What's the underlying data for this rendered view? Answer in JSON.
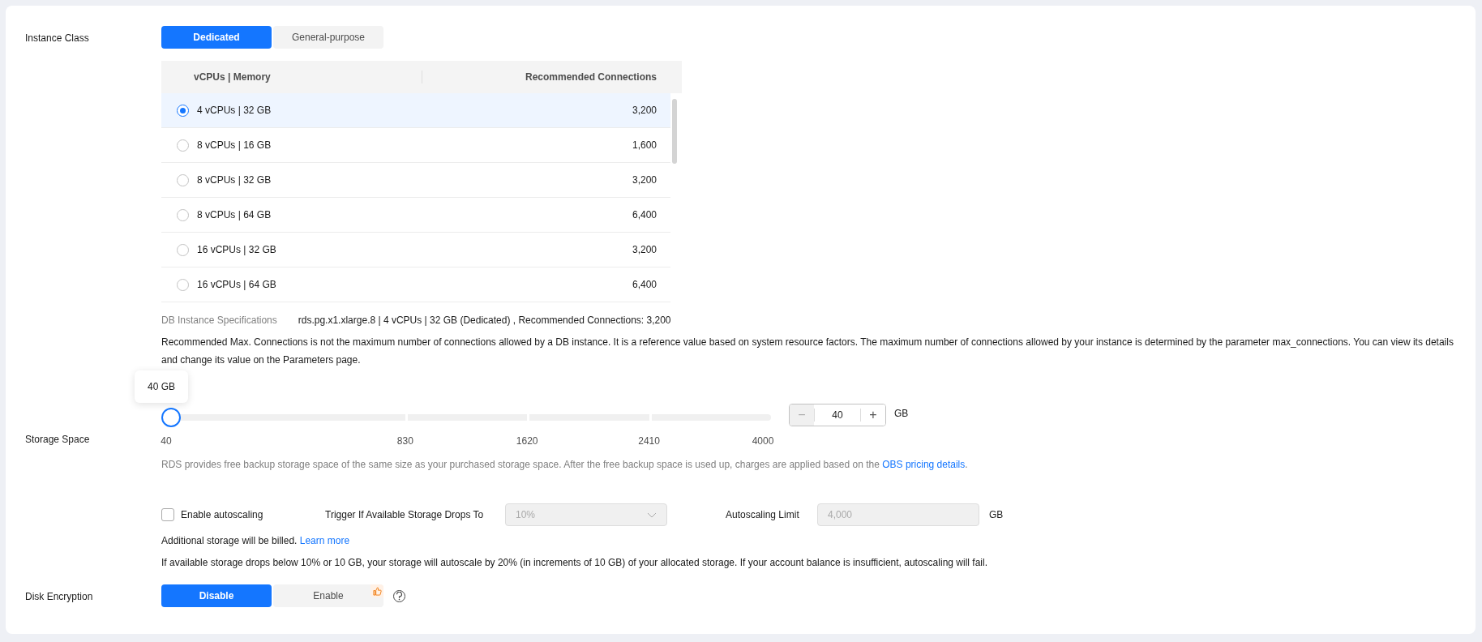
{
  "instance_class": {
    "label": "Instance Class",
    "options": [
      {
        "label": "Dedicated",
        "selected": true
      },
      {
        "label": "General-purpose",
        "selected": false
      }
    ]
  },
  "table": {
    "columns": [
      "vCPUs | Memory",
      "Recommended Connections"
    ],
    "rows": [
      {
        "spec": "4 vCPUs | 32 GB",
        "connections": "3,200",
        "selected": true
      },
      {
        "spec": "8 vCPUs | 16 GB",
        "connections": "1,600",
        "selected": false
      },
      {
        "spec": "8 vCPUs | 32 GB",
        "connections": "3,200",
        "selected": false
      },
      {
        "spec": "8 vCPUs | 64 GB",
        "connections": "6,400",
        "selected": false
      },
      {
        "spec": "16 vCPUs | 32 GB",
        "connections": "3,200",
        "selected": false
      },
      {
        "spec": "16 vCPUs | 64 GB",
        "connections": "6,400",
        "selected": false
      }
    ]
  },
  "specifications": {
    "label": "DB Instance Specifications",
    "value": "rds.pg.x1.xlarge.8 | 4 vCPUs | 32 GB (Dedicated) , Recommended Connections: 3,200"
  },
  "note": "Recommended Max. Connections is not the maximum number of connections allowed by a DB instance. It is a reference value based on system resource factors. The maximum number of connections allowed by your instance is determined by the parameter max_connections. You can view its details and change its value on the Parameters page.",
  "storage": {
    "label": "Storage Space",
    "tooltip": "40 GB",
    "level": 0,
    "ticks": [
      "40",
      "830",
      "1620",
      "2410",
      "4000"
    ],
    "value": "40",
    "minus": "−",
    "plus": "+",
    "unit": "GB",
    "hint": "RDS provides free backup storage space of the same size as your purchased storage space. After the free backup space is used up, charges are applied based on the ",
    "hint_link": "OBS pricing details",
    "hint_end": "."
  },
  "autoscaling": {
    "label": "Enable autoscaling",
    "checked": false,
    "trigger_label": "Trigger If Available Storage Drops To",
    "trigger_value": "10%",
    "limit_label": "Autoscaling Limit",
    "limit_value": "4,000",
    "limit_unit": "GB",
    "billed": "Additional storage will be billed. ",
    "learn_more": "Learn more",
    "info": "If available storage drops below 10% or 10 GB, your storage will autoscale by 20% (in increments of 10 GB) of your allocated storage. If your account balance is insufficient, autoscaling will fail."
  },
  "disk_encryption": {
    "label": "Disk Encryption",
    "options": [
      {
        "label": "Disable",
        "selected": true,
        "recommended": false
      },
      {
        "label": "Enable",
        "selected": false,
        "recommended": true
      }
    ]
  }
}
